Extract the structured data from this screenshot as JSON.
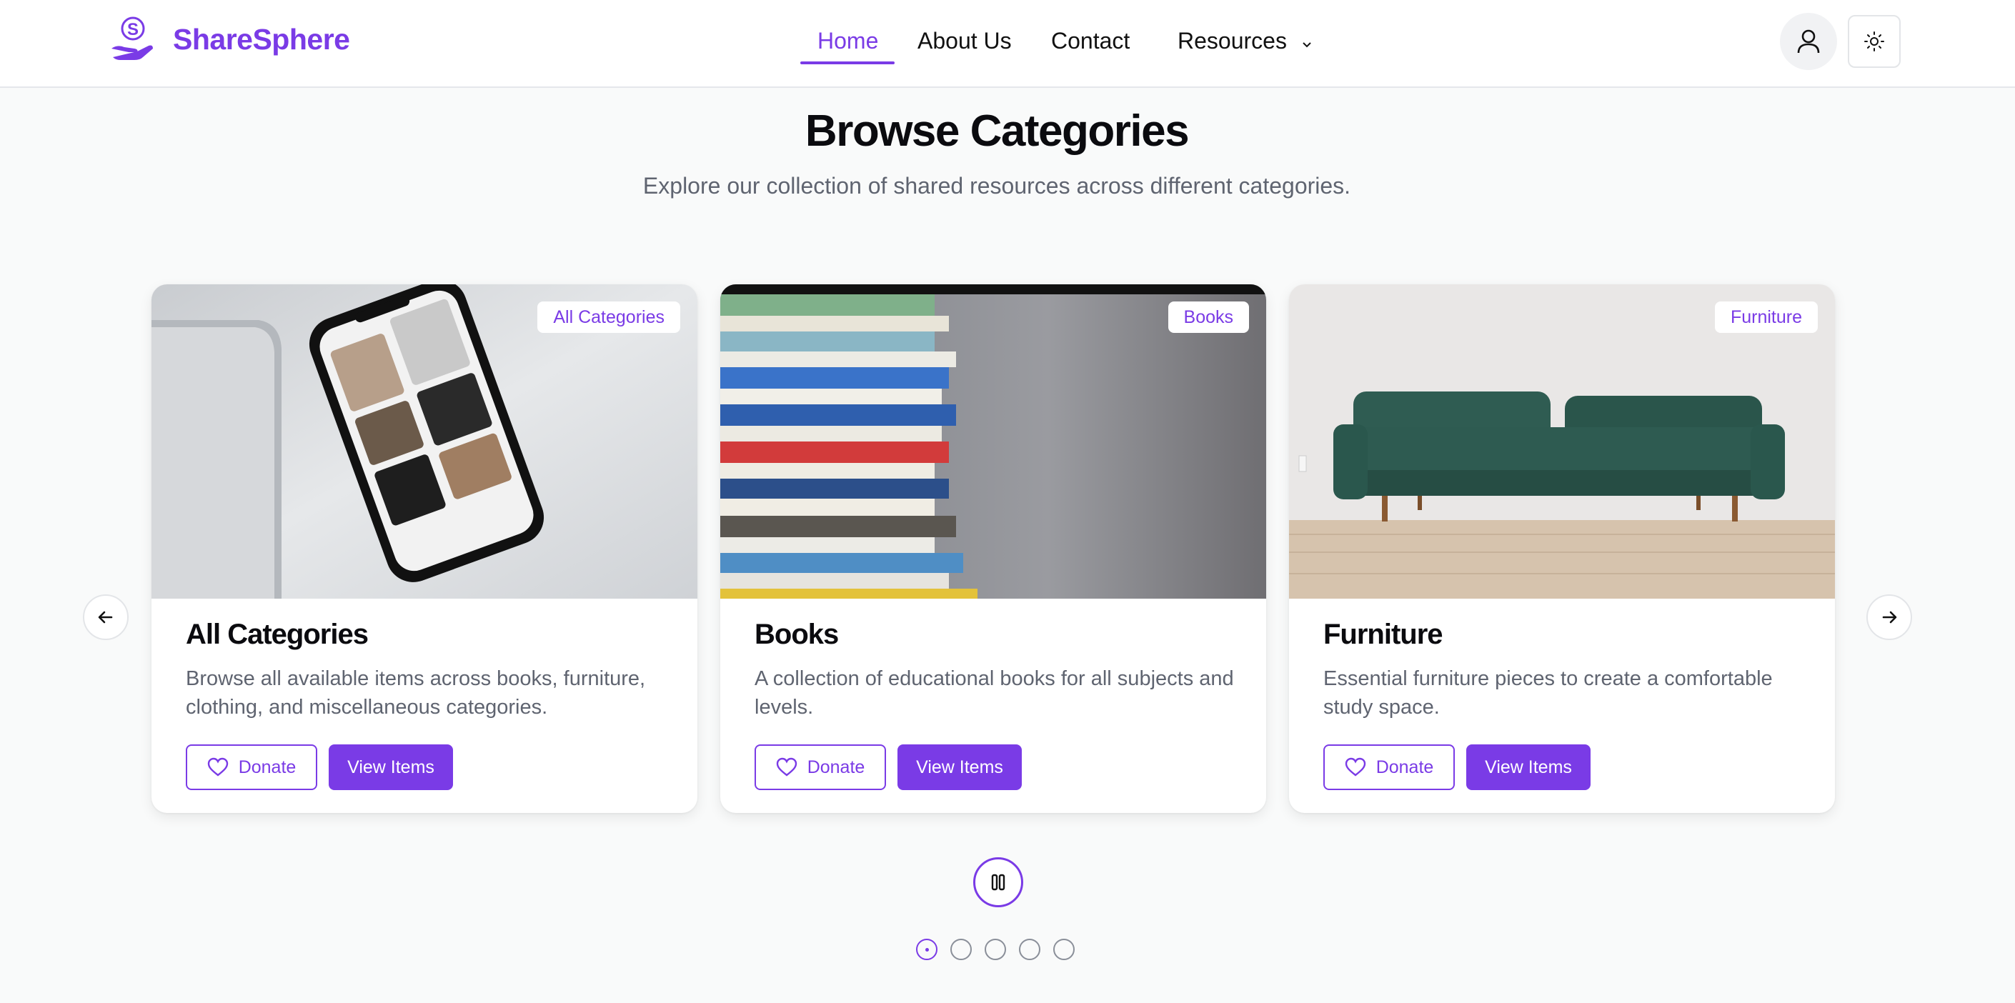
{
  "brand": {
    "name": "ShareSphere",
    "logo_icon": "hand-s-logo-icon",
    "accent": "#7a3be6"
  },
  "nav": {
    "items": [
      {
        "label": "Home",
        "active": true
      },
      {
        "label": "About Us"
      },
      {
        "label": "Contact"
      },
      {
        "label": "Resources",
        "has_dropdown": true
      }
    ],
    "user_icon": "user-icon",
    "theme_icon": "sun-icon"
  },
  "hero": {
    "title": "Browse Categories",
    "subtitle": "Explore our collection of shared resources across different categories."
  },
  "carousel": {
    "prev_icon": "arrow-left-icon",
    "next_icon": "arrow-right-icon",
    "cards": [
      {
        "badge": "All Categories",
        "title": "All Categories",
        "description": "Browse all available items across books, furniture, clothing, and miscellaneous categories.",
        "donate_label": "Donate",
        "view_label": "View Items",
        "image": "phone-on-desk"
      },
      {
        "badge": "Books",
        "title": "Books",
        "description": "A collection of educational books for all subjects and levels.",
        "donate_label": "Donate",
        "view_label": "View Items",
        "image": "stack-of-books"
      },
      {
        "badge": "Furniture",
        "title": "Furniture",
        "description": "Essential furniture pieces to create a comfortable study space.",
        "donate_label": "Donate",
        "view_label": "View Items",
        "image": "green-sofa"
      }
    ],
    "pause_icon": "pause-icon",
    "dot_count": 5,
    "active_dot": 0
  }
}
